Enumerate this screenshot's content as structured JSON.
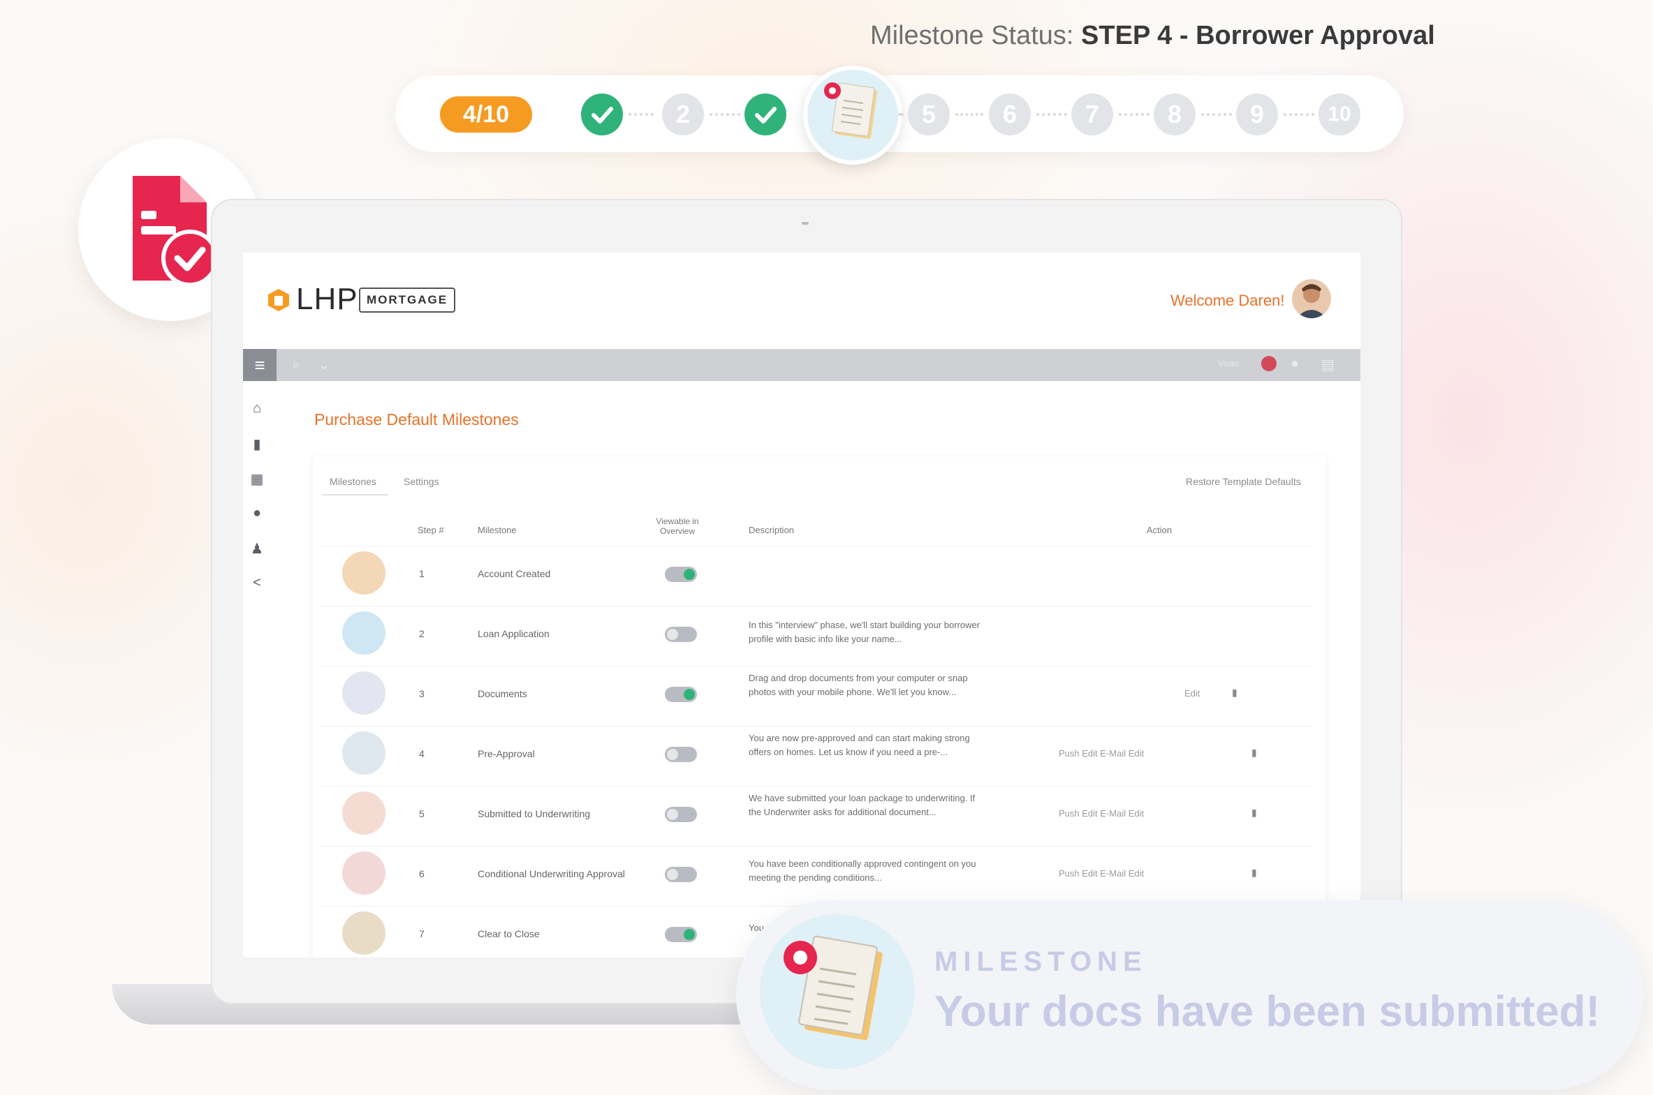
{
  "milestone_status": {
    "label": "Milestone Status:",
    "value": "STEP 4 - Borrower Approval"
  },
  "stepper": {
    "progress": "4/10",
    "steps": [
      {
        "label": "1",
        "state": "done"
      },
      {
        "label": "2",
        "state": "pending"
      },
      {
        "label": "3",
        "state": "done"
      },
      {
        "label": "4",
        "state": "current"
      },
      {
        "label": "5",
        "state": "pending"
      },
      {
        "label": "6",
        "state": "pending"
      },
      {
        "label": "7",
        "state": "pending"
      },
      {
        "label": "8",
        "state": "pending"
      },
      {
        "label": "9",
        "state": "pending"
      },
      {
        "label": "10",
        "state": "pending"
      }
    ]
  },
  "app": {
    "logo_text": "LHP",
    "logo_sub": "MORTGAGE",
    "welcome": "Welcome Daren!",
    "toolbar_right_label": "Vivan",
    "page_title": "Purchase Default Milestones",
    "tabs": [
      "Milestones",
      "Settings"
    ],
    "restore_link": "Restore Template Defaults",
    "columns": [
      "Step #",
      "Milestone",
      "Viewable in Overview",
      "Description",
      "Action"
    ],
    "rows": [
      {
        "step": "1",
        "milestone": "Account Created",
        "viewable": true,
        "description": "",
        "actions": "",
        "trash": false
      },
      {
        "step": "2",
        "milestone": "Loan Application",
        "viewable": false,
        "description": "In this \"interview\" phase, we'll start building your borrower profile with basic info like your name...",
        "actions": "",
        "trash": false
      },
      {
        "step": "3",
        "milestone": "Documents",
        "viewable": true,
        "description": "Drag and drop documents from your computer or snap photos with your mobile phone. We'll let you know...",
        "actions": "Edit",
        "trash": true
      },
      {
        "step": "4",
        "milestone": "Pre-Approval",
        "viewable": false,
        "description": "You are now pre-approved and can start making strong offers on homes. Let us know if you need a pre-...",
        "actions": "Push   Edit   E-Mail   Edit",
        "trash": true
      },
      {
        "step": "5",
        "milestone": "Submitted to Underwriting",
        "viewable": false,
        "description": "We have submitted your loan package to underwriting. If the Underwriter asks for additional document...",
        "actions": "Push   Edit   E-Mail   Edit",
        "trash": true
      },
      {
        "step": "6",
        "milestone": "Conditional Underwriting Approval",
        "viewable": false,
        "description": "You have been conditionally approved contingent on you meeting the pending conditions...",
        "actions": "Push   Edit   E-Mail   Edit",
        "trash": true
      },
      {
        "step": "7",
        "milestone": "Clear to Close",
        "viewable": true,
        "description": "You...",
        "actions": "",
        "trash": false
      }
    ]
  },
  "toast": {
    "kicker": "MILESTONE",
    "title": "Your docs have been submitted!"
  },
  "colors": {
    "accent_orange": "#e8722a",
    "badge_orange": "#f59b22",
    "done_green": "#2fb37a",
    "doc_red": "#e6264f"
  },
  "icons": {
    "doc_check": "document-check-icon",
    "sidebar": [
      "home-icon",
      "clipboard-icon",
      "calendar-icon",
      "info-icon",
      "user-icon",
      "share-icon"
    ]
  }
}
